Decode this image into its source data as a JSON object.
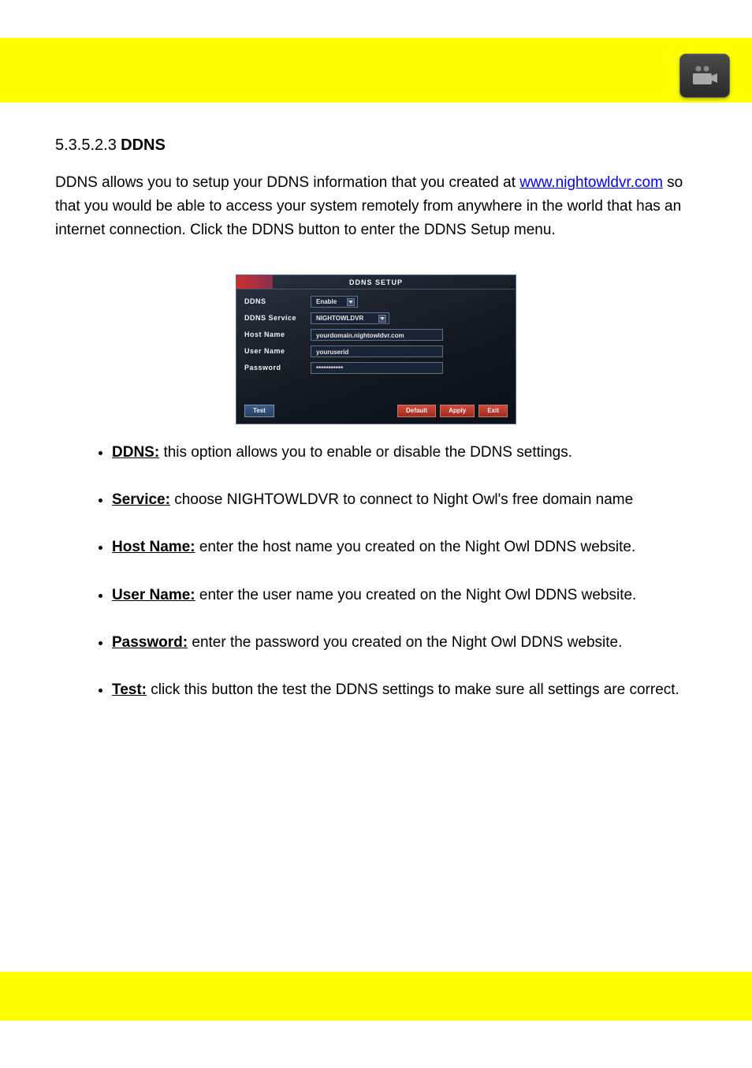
{
  "section_number": "5.3.5.2.3",
  "section_title": "DDNS",
  "intro_text_before_link": "DDNS allows you to setup your DDNS information that you created at ",
  "ddns_url": "www.nightowldvr.com",
  "intro_text_after_link": " so that you would be able to access your system remotely from anywhere in the world that has an internet connection. Click the DDNS button to enter the DDNS Setup menu.",
  "screenshot": {
    "title": "DDNS  SETUP",
    "rows": {
      "ddns_label": "DDNS",
      "ddns_value": "Enable",
      "service_label": "DDNS  Service",
      "service_value": "NIGHTOWLDVR",
      "host_label": "Host  Name",
      "host_value": "yourdomain.nightowldvr.com",
      "user_label": "User  Name",
      "user_value": "youruserid",
      "pass_label": "Password",
      "pass_value": "***********"
    },
    "buttons": {
      "test": "Test",
      "default": "Default",
      "apply": "Apply",
      "exit": "Exit"
    }
  },
  "fields": [
    {
      "name": "DDNS:",
      "desc": " this option allows you to enable or disable the DDNS settings."
    },
    {
      "name": "Service:",
      "desc": " choose NIGHTOWLDVR to connect to Night Owl's free domain name "
    },
    {
      "name": "Host Name:",
      "desc": " enter the host name you created on the Night Owl DDNS website."
    },
    {
      "name": "User Name:",
      "desc": " enter the user name you created on the Night Owl DDNS website."
    },
    {
      "name": "Password:",
      "desc": " enter the password you created on the Night Owl DDNS website. "
    },
    {
      "name": "Test:",
      "desc": " click this button the test the DDNS settings to make sure all settings are correct."
    }
  ]
}
